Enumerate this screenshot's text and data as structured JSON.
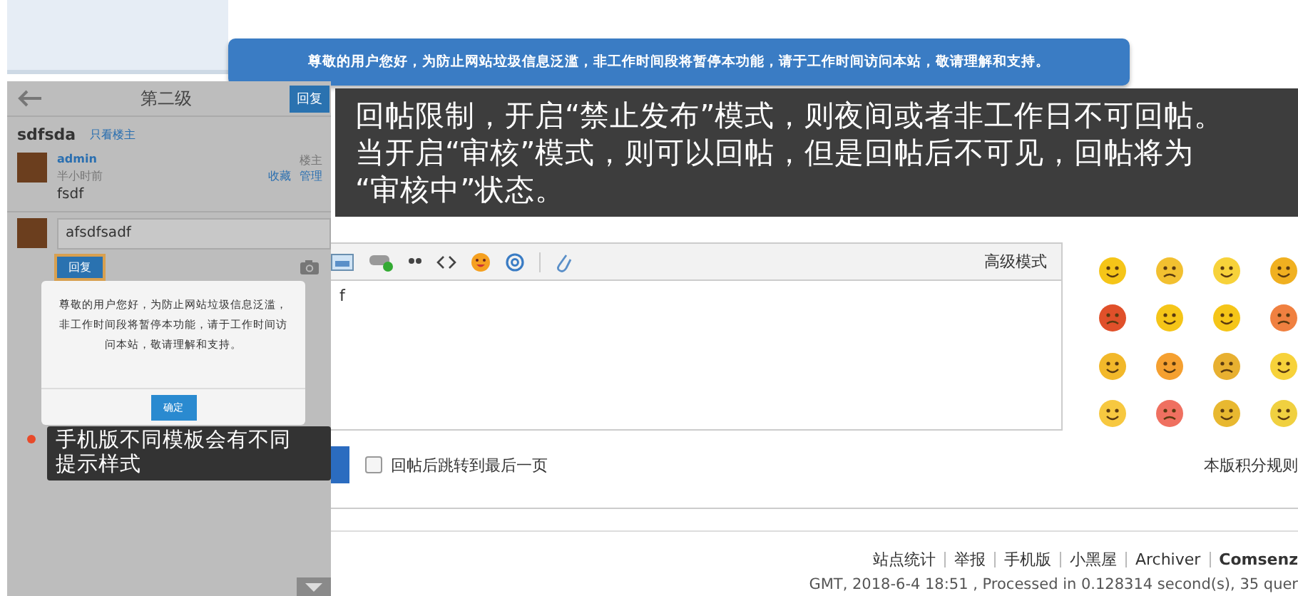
{
  "banner": {
    "text": "尊敬的用户您好，为防止网站垃圾信息泛滥，非工作时间段将暂停本功能，请于工作时间访问本站，敬请理解和支持。"
  },
  "mobile": {
    "header": {
      "title": "第二级",
      "reply_button": "回复"
    },
    "thread": {
      "title": "sdfsda",
      "filter_link": "只看楼主"
    },
    "post": {
      "author": "admin",
      "time": "半小时前",
      "role": "楼主",
      "actions": [
        "收藏",
        "管理"
      ],
      "content": "fsdf"
    },
    "reply": {
      "value": "afsdfsadf",
      "button": "回复"
    },
    "dialog": {
      "message": "尊敬的用户您好，为防止网站垃圾信息泛滥，非工作时间段将暂停本功能，请于工作时间访问本站，敬请理解和支持。",
      "button": "确定"
    }
  },
  "callouts": [
    {
      "lines": [
        "回帖限制，开启“禁止发布”模式，则夜间或者非工作日不可回帖。",
        "当开启“审核”模式，则可以回帖，但是回帖后不可见，回帖将为",
        "“审核中”状态。"
      ]
    },
    {
      "lines": [
        "手机版不同模板会有不同",
        "提示样式"
      ]
    }
  ],
  "editor": {
    "mode_link": "高级模式",
    "content": "f"
  },
  "options": {
    "label": "回帖后跳转到最后一页",
    "checked": false
  },
  "credit_rules_link": "本版积分规则",
  "footer": {
    "links": [
      "站点统计",
      "举报",
      "手机版",
      "小黑屋",
      "Archiver"
    ],
    "brand": "Comsenz",
    "info": "GMT, 2018-6-4 18:51 , Processed in 0.128314 second(s), 35 quer"
  }
}
